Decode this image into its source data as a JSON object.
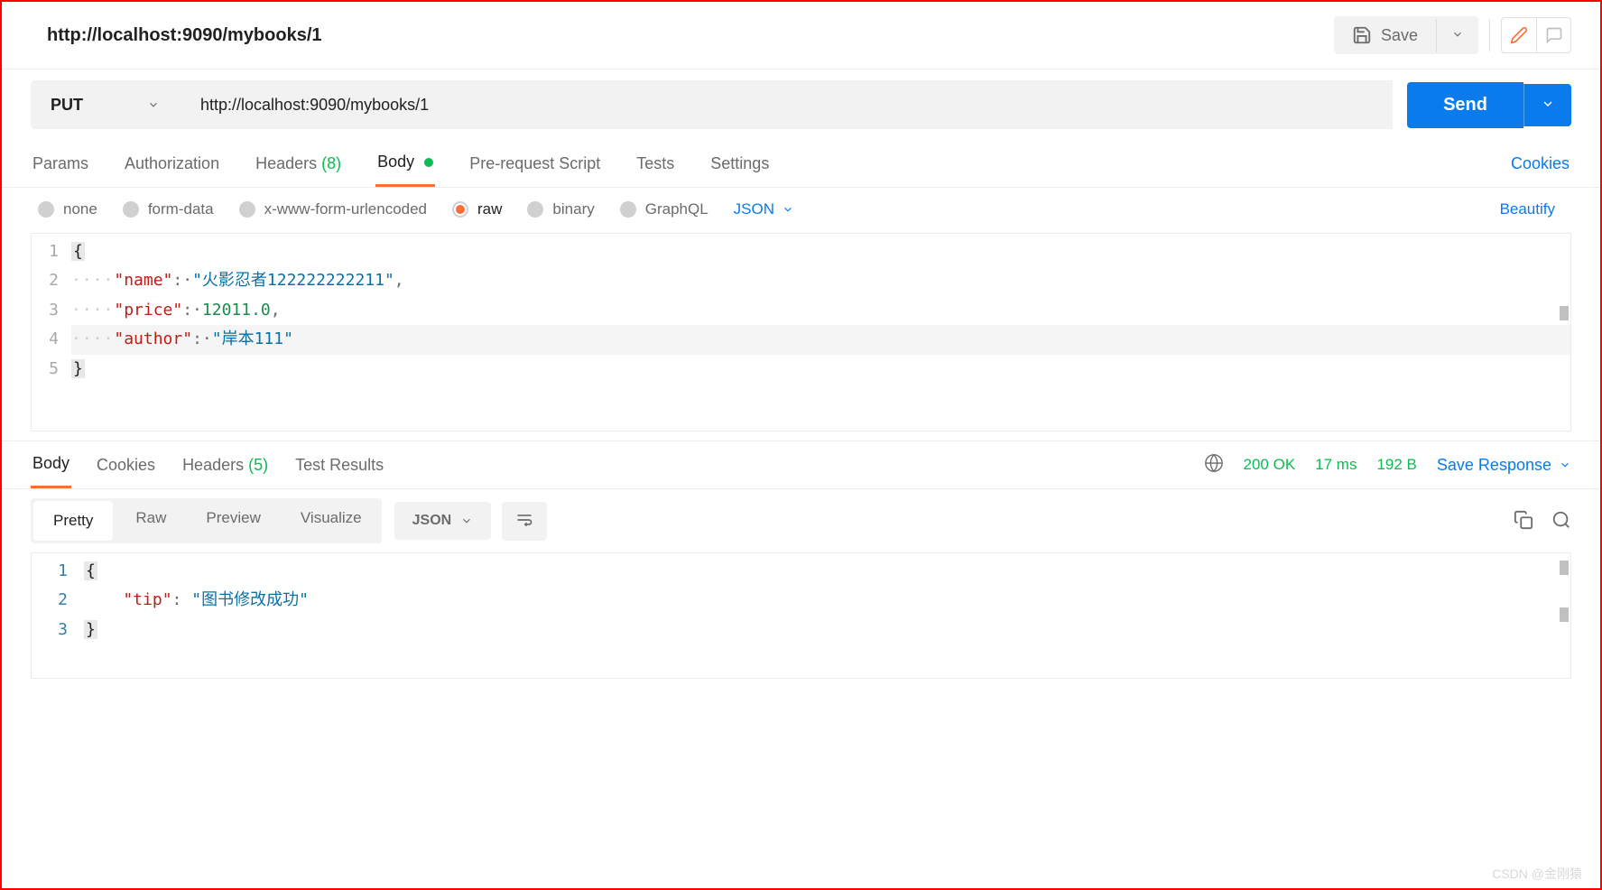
{
  "header": {
    "title": "http://localhost:9090/mybooks/1",
    "save_label": "Save"
  },
  "request": {
    "method": "PUT",
    "url": "http://localhost:9090/mybooks/1",
    "send_label": "Send"
  },
  "req_tabs": {
    "params": "Params",
    "auth": "Authorization",
    "headers_label": "Headers",
    "headers_count": "(8)",
    "body": "Body",
    "prereq": "Pre-request Script",
    "tests": "Tests",
    "settings": "Settings",
    "cookies": "Cookies"
  },
  "body_opts": {
    "none": "none",
    "formdata": "form-data",
    "urlencoded": "x-www-form-urlencoded",
    "raw": "raw",
    "binary": "binary",
    "graphql": "GraphQL",
    "format": "JSON",
    "beautify": "Beautify"
  },
  "req_body_lines": [
    {
      "num": "1",
      "content": [
        {
          "t": "brace",
          "v": "{"
        }
      ]
    },
    {
      "num": "2",
      "content": [
        {
          "t": "dots",
          "v": "····"
        },
        {
          "t": "k",
          "v": "\"name\""
        },
        {
          "t": "p",
          "v": ":·"
        },
        {
          "t": "s",
          "v": "\"火影忍者122222222211\""
        },
        {
          "t": "p",
          "v": ","
        }
      ]
    },
    {
      "num": "3",
      "content": [
        {
          "t": "dots",
          "v": "····"
        },
        {
          "t": "k",
          "v": "\"price\""
        },
        {
          "t": "p",
          "v": ":·"
        },
        {
          "t": "n",
          "v": "12011.0"
        },
        {
          "t": "p",
          "v": ","
        }
      ]
    },
    {
      "num": "4",
      "content": [
        {
          "t": "dots",
          "v": "····"
        },
        {
          "t": "k",
          "v": "\"author\""
        },
        {
          "t": "p",
          "v": ":·"
        },
        {
          "t": "s",
          "v": "\"岸本111\""
        }
      ],
      "hl": true
    },
    {
      "num": "5",
      "content": [
        {
          "t": "brace",
          "v": "}"
        }
      ]
    }
  ],
  "resp_tabs": {
    "body": "Body",
    "cookies": "Cookies",
    "headers_label": "Headers",
    "headers_count": "(5)",
    "test_results": "Test Results"
  },
  "resp_status": {
    "code": "200 OK",
    "time": "17 ms",
    "size": "192 B",
    "save_response": "Save Response"
  },
  "resp_modes": {
    "pretty": "Pretty",
    "raw": "Raw",
    "preview": "Preview",
    "visualize": "Visualize",
    "format": "JSON"
  },
  "resp_body_lines": [
    {
      "num": "1",
      "content": [
        {
          "t": "brace",
          "v": "{"
        }
      ]
    },
    {
      "num": "2",
      "content": [
        {
          "t": "plain",
          "v": "    "
        },
        {
          "t": "k",
          "v": "\"tip\""
        },
        {
          "t": "p",
          "v": ": "
        },
        {
          "t": "s",
          "v": "\"图书修改成功\""
        }
      ]
    },
    {
      "num": "3",
      "content": [
        {
          "t": "brace",
          "v": "}"
        }
      ]
    }
  ],
  "watermark": "CSDN @金刚猿"
}
